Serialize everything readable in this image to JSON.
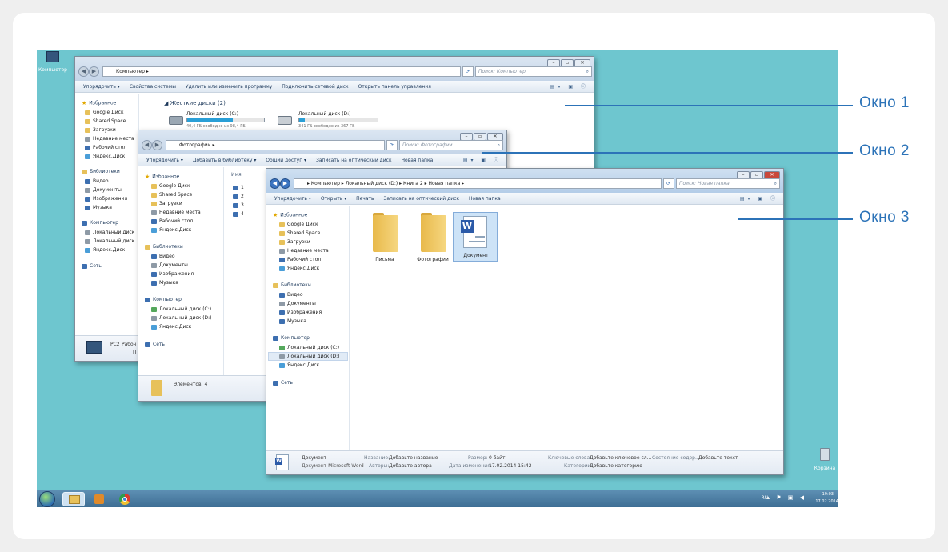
{
  "desktop": {
    "computer_icon_label": "Компьютер",
    "recycle_icon_label": "Корзина"
  },
  "win1": {
    "address": "Компьютер ▸",
    "search_placeholder": "Поиск: Компьютер",
    "cmd": [
      "Упорядочить ▾",
      "Свойства системы",
      "Удалить или изменить программу",
      "Подключить сетевой диск",
      "Открыть панель управления"
    ],
    "sidebar": [
      "Избранное",
      "Google Диск",
      "Shared Space",
      "Загрузки",
      "Недавние места",
      "Рабочий стол",
      "Яндекс.Диск",
      "Библиотеки",
      "Видео",
      "Документы",
      "Изображения",
      "Музыка",
      "Компьютер",
      "Локальный диск",
      "Локальный диск",
      "Яндекс.Диск",
      "Сеть"
    ],
    "section_title": "◢ Жесткие диски (2)",
    "drive_c_name": "Локальный диск (C:)",
    "drive_c_free": "40,4 ГБ свободно из 98,4 ГБ",
    "drive_c_used": 0.59,
    "drive_d_name": "Локальный диск (D:)",
    "drive_d_free": "341 ГБ свободно из 367 ГБ",
    "drive_d_used": 0.07,
    "status_name": "PC2",
    "status_group": "Рабоч",
    "status_extra": "П"
  },
  "win2": {
    "address": "Фотографии ▸",
    "search_placeholder": "Поиск: Фотографии",
    "cmd": [
      "Упорядочить ▾",
      "Добавить в библиотеку ▾",
      "Общий доступ ▾",
      "Записать на оптический диск",
      "Новая папка"
    ],
    "sidebar": [
      "Избранное",
      "Google Диск",
      "Shared Space",
      "Загрузки",
      "Недавние места",
      "Рабочий стол",
      "Яндекс.Диск",
      "Библиотеки",
      "Видео",
      "Документы",
      "Изображения",
      "Музыка",
      "Компьютер",
      "Локальный диск (C:)",
      "Локальный диск (D:)",
      "Яндекс.Диск",
      "Сеть"
    ],
    "column_header": "Имя",
    "files": [
      "1",
      "2",
      "3",
      "4"
    ],
    "status": "Элементов: 4"
  },
  "win3": {
    "address": "▸ Компьютер ▸ Локальный диск (D:) ▸ Книга 2 ▸ Новая папка ▸",
    "search_placeholder": "Поиск: Новая папка",
    "cmd": [
      "Упорядочить ▾",
      "Открыть ▾",
      "Печать",
      "Записать на оптический диск",
      "Новая папка"
    ],
    "sidebar": [
      "Избранное",
      "Google Диск",
      "Shared Space",
      "Загрузки",
      "Недавние места",
      "Рабочий стол",
      "Яндекс.Диск",
      "Библиотеки",
      "Видео",
      "Документы",
      "Изображения",
      "Музыка",
      "Компьютер",
      "Локальный диск (C:)",
      "Локальный диск (D:)",
      "Яндекс.Диск",
      "Сеть"
    ],
    "items": [
      "Письма",
      "Фотографии",
      "Документ"
    ],
    "details": {
      "name": "Документ",
      "type": "Документ Microsoft Word",
      "title_label": "Название:",
      "title_value": "Добавьте название",
      "authors_label": "Авторы:",
      "authors_value": "Добавьте автора",
      "size_label": "Размер:",
      "size_value": "0 байт",
      "modified_label": "Дата изменения:",
      "modified_value": "17.02.2014 15:42",
      "tags_label": "Ключевые слова:",
      "tags_value": "Добавьте ключевое сл...",
      "state_label": "Состояние содер...",
      "state_value": "Добавьте текст",
      "category_label": "Категории:",
      "category_value": "Добавьте категорию"
    }
  },
  "taskbar": {
    "lang": "RU",
    "time": "19:03",
    "date": "17.02.2014"
  },
  "labels": {
    "window1": "Окно 1",
    "window2": "Окно 2",
    "window3": "Окно 3"
  }
}
